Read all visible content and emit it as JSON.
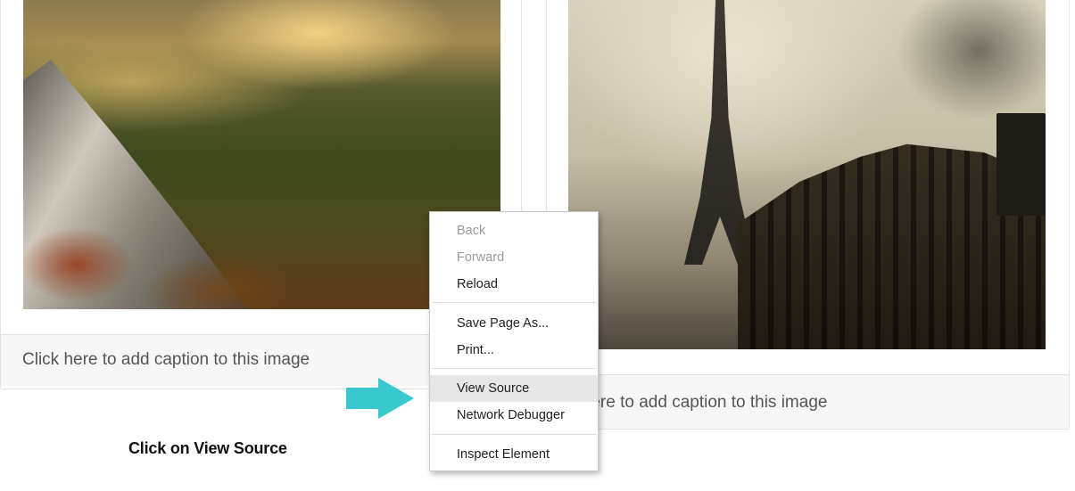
{
  "left_card": {
    "caption_placeholder": "Click here to add caption to this image"
  },
  "right_card": {
    "caption_text": "k here to add caption to this image"
  },
  "instruction": "Click on View Source",
  "context_menu": {
    "items": [
      {
        "label": "Back",
        "enabled": false
      },
      {
        "label": "Forward",
        "enabled": false
      },
      {
        "label": "Reload",
        "enabled": true
      },
      {
        "label": "Save Page As...",
        "enabled": true
      },
      {
        "label": "Print...",
        "enabled": true
      },
      {
        "label": "View Source",
        "enabled": true,
        "highlighted": true
      },
      {
        "label": "Network Debugger",
        "enabled": true
      },
      {
        "label": "Inspect Element",
        "enabled": true
      }
    ]
  },
  "colors": {
    "arrow": "#38c9cf",
    "menu_highlight": "#e7e7e7",
    "caption_bg": "#f6f6f6"
  },
  "icons": [
    "right-arrow-icon"
  ]
}
